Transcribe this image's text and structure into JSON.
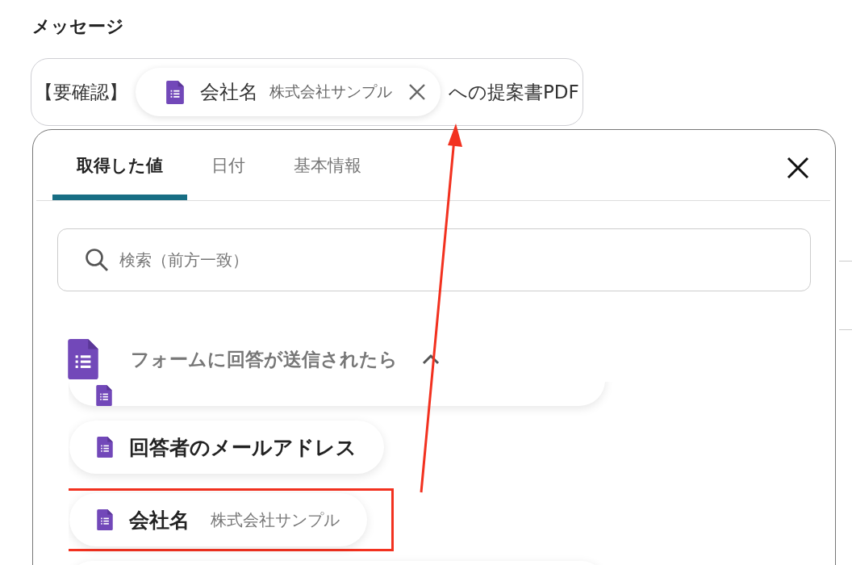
{
  "heading": "メッセージ",
  "message": {
    "parts": [
      {
        "kind": "text",
        "text": "【要確認】"
      },
      {
        "kind": "chip",
        "label": "会社名",
        "value": "株式会社サンプル"
      },
      {
        "kind": "text",
        "text": "への提案書PDF"
      }
    ]
  },
  "popup": {
    "tabs": [
      {
        "label": "取得した値",
        "selected": true
      },
      {
        "label": "日付",
        "selected": false
      },
      {
        "label": "基本情報",
        "selected": false
      }
    ],
    "search": {
      "placeholder": "検索（前方一致）"
    },
    "section": {
      "title": "フォームに回答が送信されたら",
      "expanded": true,
      "items": [
        {
          "kind": "clipped"
        },
        {
          "kind": "item",
          "label": "回答者のメールアドレス",
          "highlighted": false
        },
        {
          "kind": "item",
          "label": "会社名",
          "value": "株式会社サンプル",
          "highlighted": true
        },
        {
          "kind": "clipped"
        }
      ]
    }
  }
}
